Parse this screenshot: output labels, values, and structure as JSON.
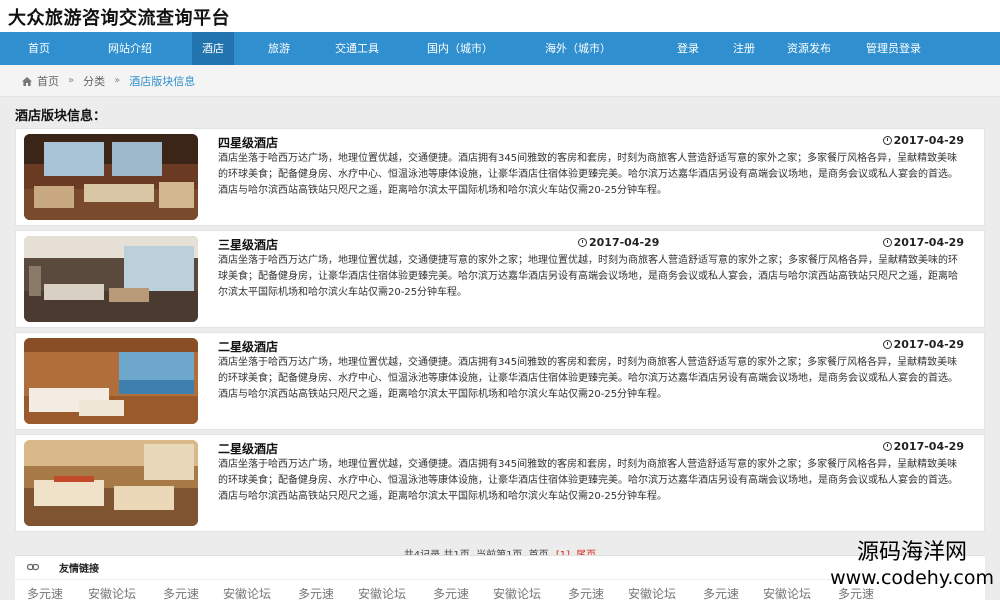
{
  "site": {
    "title": "大众旅游咨询交流查询平台"
  },
  "nav": [
    {
      "label": "首页"
    },
    {
      "label": "网站介绍"
    },
    {
      "label": "酒店"
    },
    {
      "label": "旅游"
    },
    {
      "label": "交通工具"
    },
    {
      "label": "国内（城市）"
    },
    {
      "label": "海外（城市）"
    },
    {
      "label": "登录"
    },
    {
      "label": "注册"
    },
    {
      "label": "资源发布"
    },
    {
      "label": "管理员登录"
    }
  ],
  "breadcrumb": {
    "home": "首页",
    "category": "分类",
    "current": "酒店版块信息",
    "sep": "»"
  },
  "section": {
    "title": "酒店版块信息："
  },
  "hotels": [
    {
      "name": "四星级酒店",
      "date": "2017-04-29",
      "desc": "酒店坐落于哈西万达广场，地理位置优越，交通便捷。酒店拥有345间雅致的客房和套房，时刻为商旅客人营造舒适写意的家外之家；多家餐厅风格各异，呈献精致美味的环球美食；配备健身房、水疗中心、恒温泳池等康体设施，让豪华酒店住宿体验更臻完美。哈尔滨万达嘉华酒店另设有高端会议场地，是商务会议或私人宴会的首选。酒店与哈尔滨西站高铁站只咫尺之遥，距离哈尔滨太平国际机场和哈尔滨火车站仅需20-25分钟车程。"
    },
    {
      "name": "三星级酒店",
      "date": "2017-04-29",
      "date2": "2017-04-29",
      "desc": "酒店坐落于哈西万达广场，地理位置优越，交通便捷写意的家外之家；地理位置优越，时刻为商旅客人营造舒适写意的家外之家；多家餐厅风格各异，呈献精致美味的环球美食；配备健身房，让豪华酒店住宿体验更臻完美。哈尔滨万达嘉华酒店另设有高端会议场地，是商务会议或私人宴会，酒店与哈尔滨西站高铁站只咫尺之遥，距离哈尔滨太平国际机场和哈尔滨火车站仅需20-25分钟车程。"
    },
    {
      "name": "二星级酒店",
      "date": "2017-04-29",
      "desc": "酒店坐落于哈西万达广场，地理位置优越，交通便捷。酒店拥有345间雅致的客房和套房，时刻为商旅客人营造舒适写意的家外之家；多家餐厅风格各异，呈献精致美味的环球美食；配备健身房、水疗中心、恒温泳池等康体设施，让豪华酒店住宿体验更臻完美。哈尔滨万达嘉华酒店另设有高端会议场地，是商务会议或私人宴会的首选。酒店与哈尔滨西站高铁站只咫尺之遥，距离哈尔滨太平国际机场和哈尔滨火车站仅需20-25分钟车程。"
    },
    {
      "name": "二星级酒店",
      "date": "2017-04-29",
      "desc": "酒店坐落于哈西万达广场，地理位置优越，交通便捷。酒店拥有345间雅致的客房和套房，时刻为商旅客人营造舒适写意的家外之家；多家餐厅风格各异，呈献精致美味的环球美食；配备健身房、水疗中心、恒温泳池等康体设施，让豪华酒店住宿体验更臻完美。哈尔滨万达嘉华酒店另设有高端会议场地，是商务会议或私人宴会的首选。酒店与哈尔滨西站高铁站只咫尺之遥，距离哈尔滨太平国际机场和哈尔滨火车站仅需20-25分钟车程。"
    }
  ],
  "pager": {
    "summary": "共4记录,共1页, 当前第1页",
    "first": "首页",
    "current": "[1]",
    "last": "尾页"
  },
  "links": {
    "title": "友情链接",
    "items": [
      "多元速",
      "安徽论坛",
      "多元速",
      "安徽论坛",
      "多元速",
      "安徽论坛",
      "多元速",
      "安徽论坛",
      "多元速",
      "安徽论坛",
      "多元速",
      "安徽论坛",
      "多元速"
    ]
  },
  "watermark": {
    "line1": "源码海洋网",
    "line2": "www.codehy.com"
  },
  "colors": {
    "nav": "#2f8fcf",
    "nav_active": "#2174ad",
    "accent_red": "#d0301f"
  }
}
